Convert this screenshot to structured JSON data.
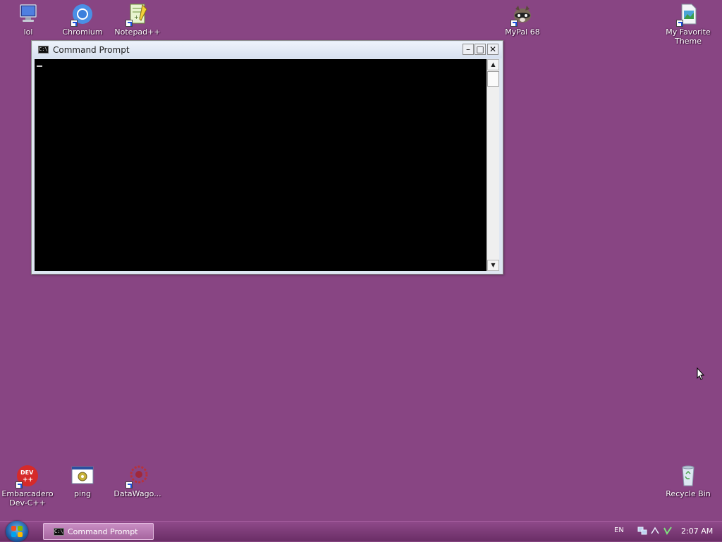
{
  "desktop": {
    "background": "#884583",
    "icons_top": [
      {
        "label": "lol"
      },
      {
        "label": "Chromium"
      },
      {
        "label": "Notepad++"
      },
      {
        "label": "MyPal 68"
      },
      {
        "label": "My Favorite Theme"
      }
    ],
    "icons_bottom": [
      {
        "label": "Embarcadero Dev-C++"
      },
      {
        "label": "ping"
      },
      {
        "label": "DataWago..."
      },
      {
        "label": "Recycle Bin"
      }
    ]
  },
  "window": {
    "title": "Command Prompt",
    "icon_text": "C:\\",
    "minimize_glyph": "–",
    "maximize_glyph": "□",
    "close_glyph": "✕",
    "console_background": "#000000",
    "console_text": ""
  },
  "taskbar": {
    "task_label": "Command Prompt",
    "language": "EN",
    "clock": "2:07 AM"
  }
}
